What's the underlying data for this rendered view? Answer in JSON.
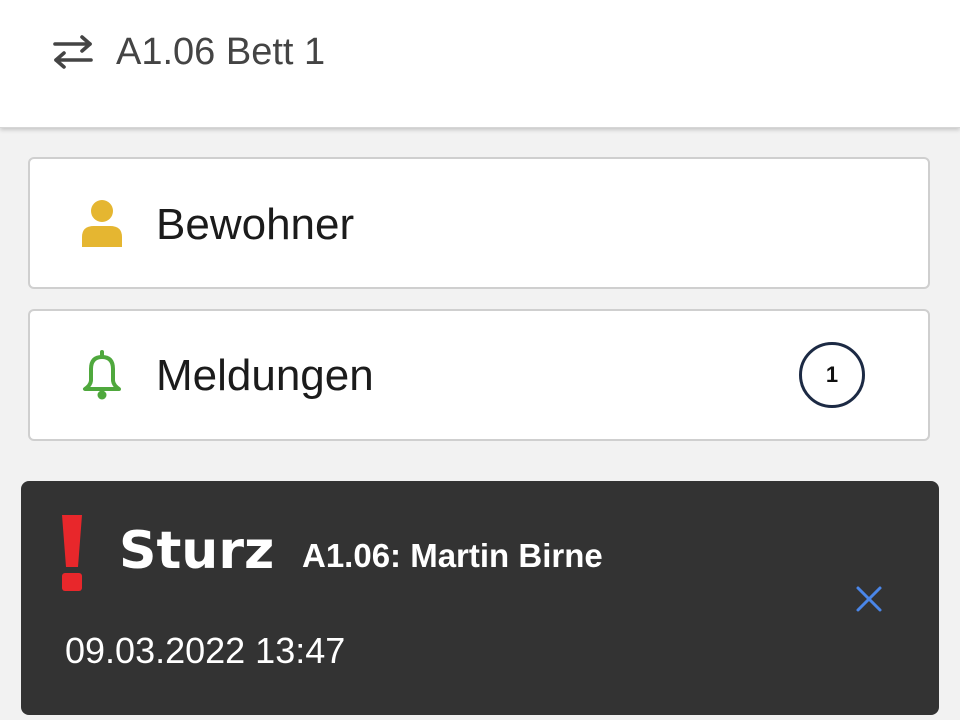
{
  "header": {
    "title": "A1.06 Bett 1",
    "icon": "swap-arrows-icon"
  },
  "cards": {
    "bewohner": {
      "label": "Bewohner",
      "icon": "person-icon",
      "icon_color": "#e5b631"
    },
    "meldungen": {
      "label": "Meldungen",
      "icon": "bell-icon",
      "icon_color": "#4fa83d",
      "badge_count": "1"
    }
  },
  "alert": {
    "type": "Sturz",
    "resident": "A1.06: Martin Birne",
    "timestamp": "09.03.2022 13:47",
    "icon": "exclamation-icon",
    "icon_color": "#e8272b",
    "close_icon": "close-icon",
    "close_color": "#4a86e8",
    "background": "#333333"
  }
}
